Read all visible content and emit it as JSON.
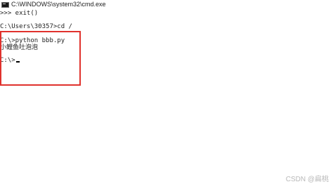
{
  "window": {
    "title": "C:\\WINDOWS\\system32\\cmd.exe",
    "icon": "cmd-icon"
  },
  "console": {
    "lines": [
      ">>> exit()",
      "C:\\Users\\30357>cd /",
      "C:\\>python bbb.py",
      "小鲤鱼吐泡泡",
      "C:\\>"
    ]
  },
  "colors": {
    "highlight": "#e0322d",
    "text": "#1f1f1f"
  },
  "watermark": "CSDN @扁桃"
}
